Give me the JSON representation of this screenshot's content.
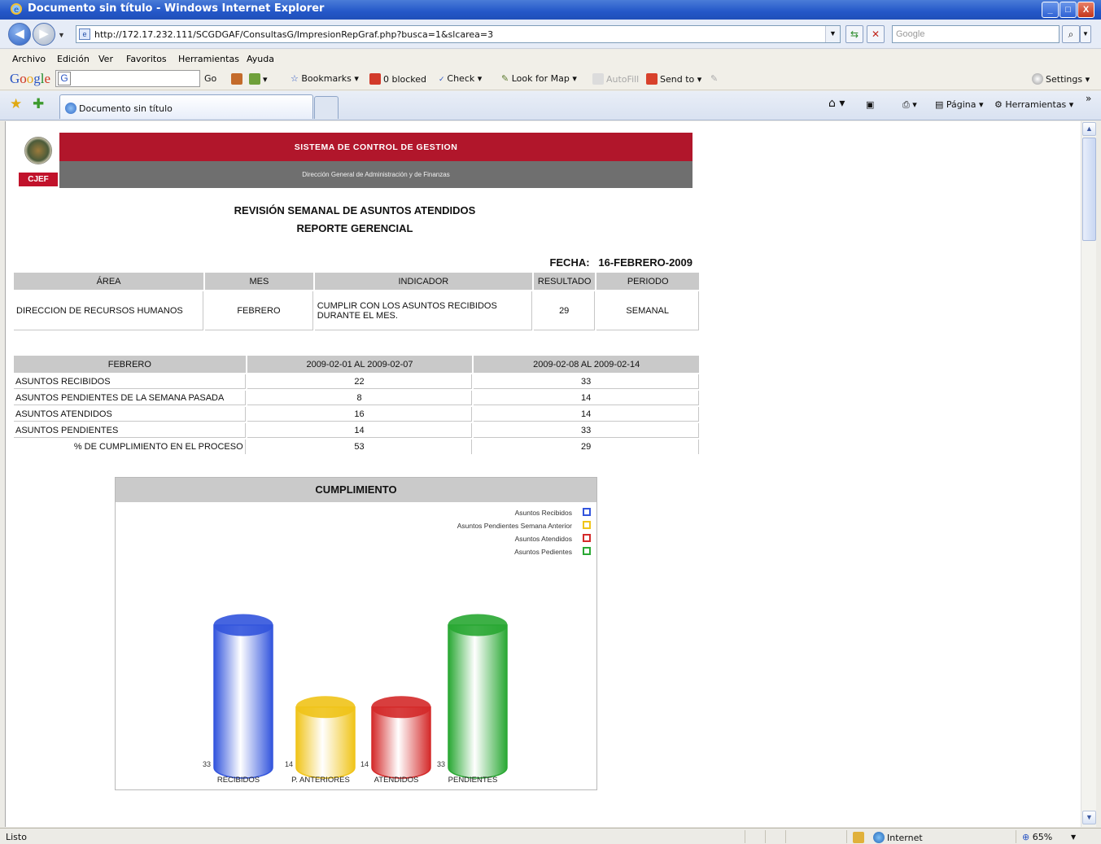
{
  "window": {
    "title": "Documento sin título - Windows Internet Explorer",
    "controls": [
      "_",
      "□",
      "X"
    ]
  },
  "address_bar": {
    "url": "http://172.17.232.111/SCGDGAF/ConsultasG/ImpresionRepGraf.php?busca=1&slcarea=3",
    "search_placeholder": "Google"
  },
  "menu": [
    "Archivo",
    "Edición",
    "Ver",
    "Favoritos",
    "Herramientas",
    "Ayuda"
  ],
  "google_toolbar": {
    "go": "Go",
    "bookmarks": "Bookmarks",
    "blocked": "0 blocked",
    "check": "Check",
    "look_for_map": "Look for Map",
    "autofill": "AutoFill",
    "send_to": "Send to",
    "settings": "Settings"
  },
  "tabs": [
    {
      "label": "Documento sin título"
    }
  ],
  "command_bar": {
    "pagina": "Página",
    "herramientas": "Herramientas"
  },
  "page": {
    "banner_title": "SISTEMA DE CONTROL DE GESTION",
    "banner_subtitle": "Dirección General de Administración y de Finanzas",
    "logo_text": "CJEF",
    "report_title": "REVISIÓN SEMANAL DE ASUNTOS ATENDIDOS",
    "report_subtitle": "REPORTE GERENCIAL",
    "fecha_label": "FECHA:",
    "fecha_value": "16-FEBRERO-2009",
    "summary_table": {
      "headers": [
        "ÁREA",
        "MES",
        "INDICADOR",
        "RESULTADO",
        "PERIODO"
      ],
      "row": [
        "DIRECCION DE RECURSOS HUMANOS",
        "FEBRERO",
        "CUMPLIR CON LOS ASUNTOS RECIBIDOS DURANTE EL MES.",
        "29",
        "SEMANAL"
      ]
    },
    "weekly_table": {
      "headers": [
        "FEBRERO",
        "2009-02-01 AL 2009-02-07",
        "2009-02-08 AL 2009-02-14"
      ],
      "rows": [
        [
          "ASUNTOS RECIBIDOS",
          "22",
          "33"
        ],
        [
          "ASUNTOS PENDIENTES DE LA SEMANA PASADA",
          "8",
          "14"
        ],
        [
          "ASUNTOS ATENDIDOS",
          "16",
          "14"
        ],
        [
          "ASUNTOS PENDIENTES",
          "14",
          "33"
        ],
        [
          "% DE CUMPLIMIENTO EN EL PROCESO",
          "53",
          "29"
        ]
      ]
    }
  },
  "chart_data": {
    "type": "bar",
    "title": "CUMPLIMIENTO",
    "categories": [
      "RECIBIDOS",
      "P. ANTERIORES",
      "ATENDIDOS",
      "PENDIENTES"
    ],
    "values": [
      33,
      14,
      14,
      33
    ],
    "colors": [
      "#3355dd",
      "#f0c419",
      "#d42a2a",
      "#29a833"
    ],
    "legend": [
      "Asuntos Recibidos",
      "Asuntos Pendientes Semana Anterior",
      "Asuntos Atendidos",
      "Asuntos Pedientes"
    ],
    "legend_position": "top-right",
    "ylim": [
      0,
      33
    ],
    "grid": false
  },
  "status_bar": {
    "text": "Listo",
    "zone": "Internet",
    "zoom": "65%"
  }
}
